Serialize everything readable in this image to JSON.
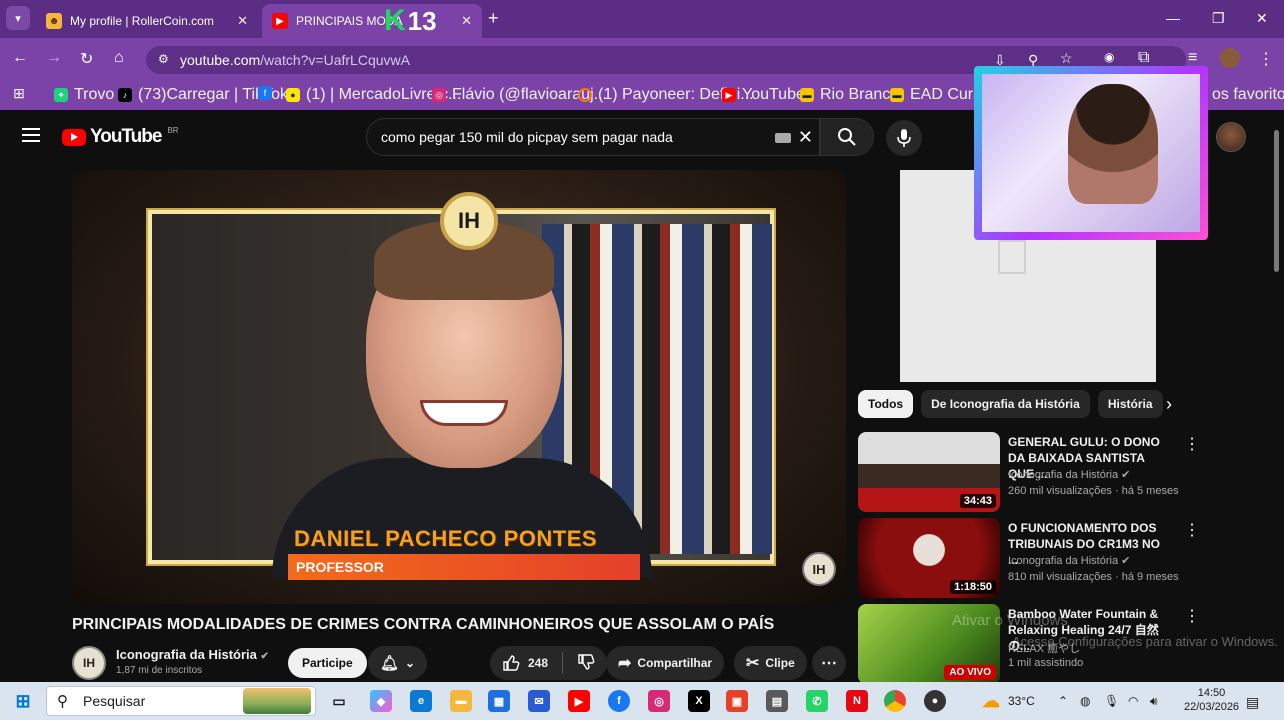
{
  "browser": {
    "tabs": [
      {
        "title": "My profile | RollerCoin.com",
        "active": false
      },
      {
        "title": "PRINCIPAIS MODA",
        "title_tail": "DE",
        "active": true
      }
    ],
    "overlay_badge": {
      "letter": "K",
      "number": "13"
    },
    "url": "youtube.com",
    "url_path": "/watch?v=UafrLCquvwA",
    "bookmarks": [
      "Trovo",
      "(73)Carregar | TikTok",
      "(1) | MercadoLivre.c...",
      "Flávio (@flavioarauj...",
      "(1) Payoneer: Defini...",
      "YouTube",
      "Rio Branco",
      "EAD Cursos",
      "os favoritos"
    ]
  },
  "youtube": {
    "logo_text": "YouTube",
    "region": "BR",
    "search_query": "como pegar 150 mil do picpay sem pagar nada",
    "video": {
      "overlay_logo": "IH",
      "lower_third_name": "DANIEL PACHECO PONTES",
      "lower_third_role": "PROFESSOR",
      "title": "PRINCIPAIS MODALIDADES DE CRIMES CONTRA CAMINHONEIROS QUE ASSOLAM O PAÍS",
      "channel": "Iconografia da História",
      "subscribers": "1,87 mi de inscritos",
      "join_label": "Participe",
      "likes": "248",
      "share_label": "Compartilhar",
      "clip_label": "Clipe"
    },
    "chips": [
      "Todos",
      "De Iconografia da História",
      "História"
    ],
    "recommendations": [
      {
        "title": "GENERAL GULU: O DONO DA BAIXADA SANTISTA QUE ...",
        "channel": "Iconografia da História",
        "meta": "260 mil visualizações · há 5 meses",
        "duration": "34:43"
      },
      {
        "title": "O FUNCIONAMENTO DOS TRIBUNAIS DO CR1M3 NO ...",
        "channel": "Iconografia da História",
        "meta": "810 mil visualizações · há 9 meses",
        "duration": "1:18:50"
      },
      {
        "title": "Bamboo Water Fountain & Relaxing Healing 24/7 自然の...",
        "channel": "RELAX 癒やし",
        "meta": "1 mil assistindo",
        "duration": "AO VIVO"
      }
    ],
    "watermark_line1": "Ativar o Windows",
    "watermark_line2": "Acesse Configurações para ativar o Windows."
  },
  "taskbar": {
    "search_placeholder": "Pesquisar",
    "temperature": "33°C",
    "time": "14:50",
    "date": "22/03/2026"
  },
  "colors": {
    "browser_frame": "#5b2d84",
    "toolbar": "#7b43a8",
    "youtube_bg": "#0f0f0f",
    "youtube_red": "#ff0000",
    "lower_third_orange": "#f36b1a"
  }
}
